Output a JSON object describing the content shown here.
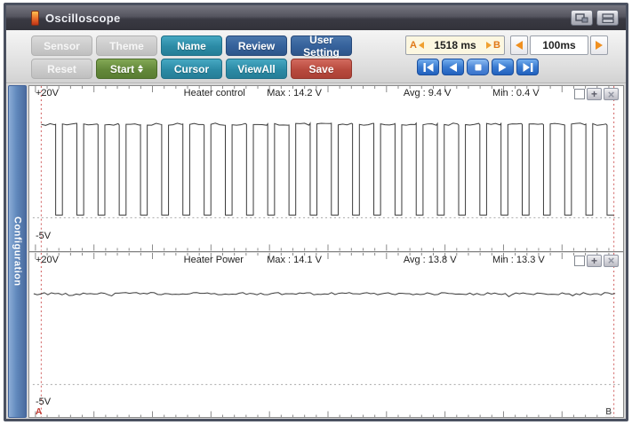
{
  "window": {
    "title": "Oscilloscope"
  },
  "toolbar": {
    "buttons": [
      {
        "label": "Sensor",
        "style": "disabled"
      },
      {
        "label": "Theme",
        "style": "disabled"
      },
      {
        "label": "Name",
        "style": "teal"
      },
      {
        "label": "Review",
        "style": "blue"
      },
      {
        "label": "User Setting",
        "style": "blue"
      },
      {
        "label": "Reset",
        "style": "disabled"
      },
      {
        "label": "Start",
        "style": "green",
        "has_spinner": true
      },
      {
        "label": "Cursor",
        "style": "teal"
      },
      {
        "label": "ViewAll",
        "style": "teal"
      },
      {
        "label": "Save",
        "style": "red"
      }
    ]
  },
  "time_controls": {
    "marker_a": "A",
    "range_value": "1518 ms",
    "marker_b": "B",
    "timebase": "100ms"
  },
  "playback_buttons": [
    "skip-to-start",
    "step-back",
    "stop",
    "play",
    "skip-to-end"
  ],
  "sidebar": {
    "config_tab": "Configuration"
  },
  "channel_controls": {
    "plus_label": "+",
    "close_label": "×"
  },
  "icons": {
    "title_icon": "orange-level-bar",
    "titlebar_buttons": [
      "float-window-icon",
      "tile-windows-icon"
    ],
    "ab_arrows": "orange-triangles",
    "playback": [
      "bar-left-triangle",
      "left-triangle",
      "white-square",
      "right-triangle",
      "right-triangle-bar"
    ]
  },
  "colors": {
    "accent_teal": "#2b8aa5",
    "accent_blue": "#35619b",
    "accent_green": "#63883a",
    "accent_red": "#b84a3e",
    "playback_blue": "#3a7bd0",
    "cursor_red": "#cf5b5b",
    "arrow_orange": "#f09020",
    "ab_box_bg": "#fcf7e0",
    "config_tab_blue": "#6189bd"
  },
  "chart_data": [
    {
      "type": "line",
      "title": "Heater control",
      "waveform": "square",
      "x_window_ms": 1518,
      "ylim": [
        -5,
        20
      ],
      "y_top_label": "+20V",
      "y_bottom_label": "-5V",
      "zero_line_v": 0,
      "high_v": 14.2,
      "low_v": 0.4,
      "periods_visible": 27,
      "duty_cycle": 0.68,
      "stats": {
        "max_v": 14.2,
        "avg_v": 9.4,
        "min_v": 0.4
      },
      "labels": {
        "max": "Max : 14.2 V",
        "avg": "Avg : 9.4 V",
        "min": "Min : 0.4 V"
      }
    },
    {
      "type": "line",
      "title": "Heater Power",
      "waveform": "noisy_flat",
      "x_window_ms": 1518,
      "ylim": [
        -5,
        20
      ],
      "y_top_label": "+20V",
      "y_bottom_label": "-5V",
      "zero_line_v": 0,
      "level_v": 13.8,
      "noise_amp_v": 0.35,
      "stats": {
        "max_v": 14.1,
        "avg_v": 13.8,
        "min_v": 13.3
      },
      "labels": {
        "max": "Max : 14.1 V",
        "avg": "Avg : 13.8 V",
        "min": "Min : 13.3 V"
      },
      "markers": {
        "a": "A",
        "b": "B"
      }
    }
  ]
}
